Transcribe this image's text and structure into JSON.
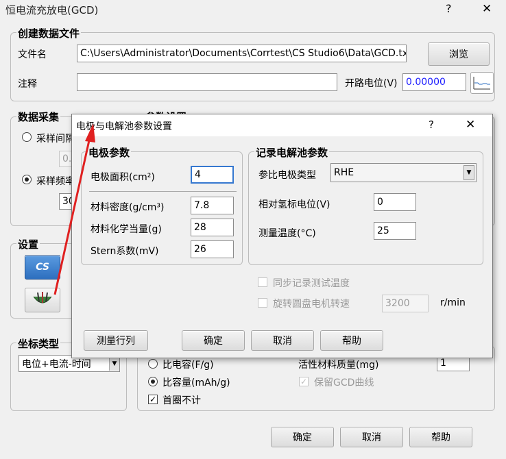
{
  "window": {
    "title": "恒电流充放电(GCD)",
    "help": "?",
    "close": "✕"
  },
  "create_file": {
    "title": "创建数据文件",
    "filename_label": "文件名",
    "filename_value": "C:\\Users\\Administrator\\Documents\\Corrtest\\CS Studio6\\Data\\GCD.txt",
    "browse_label": "浏览",
    "note_label": "注释",
    "note_value": "",
    "ocp_label": "开路电位(V)",
    "ocp_value": "0.00000"
  },
  "data_sampling": {
    "title": "数据采集",
    "interval_label": "采样间隔",
    "interval_value": "0.",
    "freq_label": "采样频率",
    "freq_value": "30",
    "selected": "freq"
  },
  "param_settings": {
    "title": "参数设置"
  },
  "settings": {
    "title": "设置",
    "cs_icon_text": "CS"
  },
  "coord": {
    "title": "坐标类型",
    "selected": "电位+电流-时间"
  },
  "lower": {
    "specific_capacitance": "比电容(F/g)",
    "specific_capacity": "比容量(mAh/g)",
    "capacity_selected": true,
    "skip_first": "首圈不计",
    "skip_first_checked": true,
    "active_mass_label": "活性材料质量(mg)",
    "active_mass_value": "1",
    "keep_gcd": "保留GCD曲线"
  },
  "main_buttons": {
    "ok": "确定",
    "cancel": "取消",
    "help": "帮助"
  },
  "dialog": {
    "title": "电极与电解池参数设置",
    "help": "?",
    "close": "✕",
    "electrode": {
      "title": "电极参数",
      "area_label": "电极面积(cm²)",
      "area_value": "4",
      "density_label": "材料密度(g/cm³)",
      "density_value": "7.8",
      "equiv_label": "材料化学当量(g)",
      "equiv_value": "28",
      "stern_label": "Stern系数(mV)",
      "stern_value": "26"
    },
    "cell": {
      "title": "记录电解池参数",
      "ref_type_label": "参比电极类型",
      "ref_type_value": "RHE",
      "rel_pot_label": "相对氢标电位(V)",
      "rel_pot_value": "0",
      "temp_label": "测量温度(°C)",
      "temp_value": "25"
    },
    "sync_temp": "同步记录测试温度",
    "rotate_speed": "旋转圆盘电机转速",
    "rotate_value": "3200",
    "rotate_unit": "r/min",
    "buttons": {
      "measure": "测量行列",
      "ok": "确定",
      "cancel": "取消",
      "help": "帮助"
    }
  },
  "colors": {
    "ocp_text": "#1a1aff",
    "annotation_arrow": "#e02020",
    "cs_icon_bg": "#2d6fbf"
  }
}
